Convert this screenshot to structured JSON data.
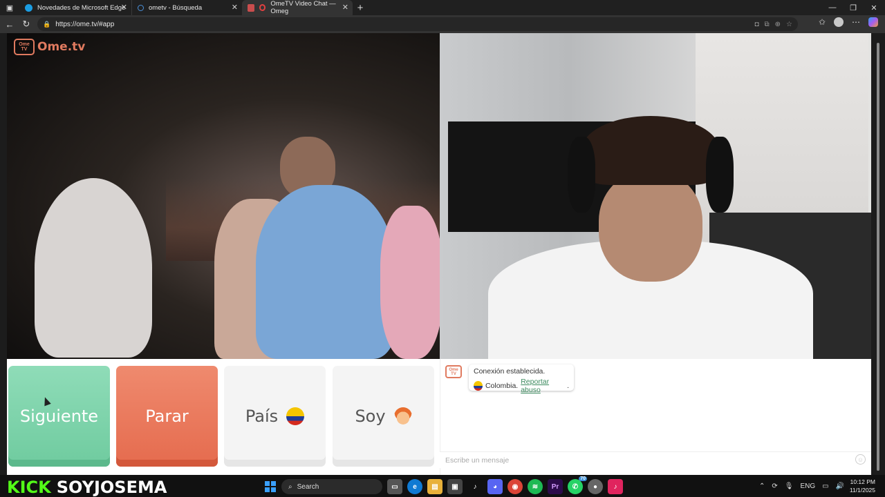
{
  "browser": {
    "tabs": [
      {
        "label": "Novedades de Microsoft Edge",
        "icon": "edge-icon",
        "color": "#1b9de2"
      },
      {
        "label": "ometv - Búsqueda",
        "icon": "search-icon",
        "color": "#4a90d9"
      },
      {
        "label": "OmeTV Video Chat — Omeg",
        "icon": "record-icon",
        "color": "#e04040"
      }
    ],
    "url": "https://ome.tv/#app"
  },
  "site": {
    "logo_badge": "Ome TV",
    "logo_text": "Ome.tv"
  },
  "controls": {
    "next_label": "Siguiente",
    "stop_label": "Parar",
    "country_label": "País",
    "gender_label": "Soy"
  },
  "chat": {
    "status": "Conexión establecida.",
    "country": "Colombia.",
    "report_link": "Reportar abuso",
    "report_suffix": ".",
    "placeholder": "Escribe un mensaje"
  },
  "overlay": {
    "platform": "KICK",
    "username": "SOYJOSEMA"
  },
  "taskbar": {
    "search_label": "Search",
    "language": "ENG",
    "time": "10:12 PM",
    "date": "11/1/2025",
    "whatsapp_badge": "70"
  },
  "colors": {
    "next": "#6fcb9f",
    "stop": "#e56b4e",
    "brand": "#e07a5f",
    "kick_green": "#53fc18"
  }
}
